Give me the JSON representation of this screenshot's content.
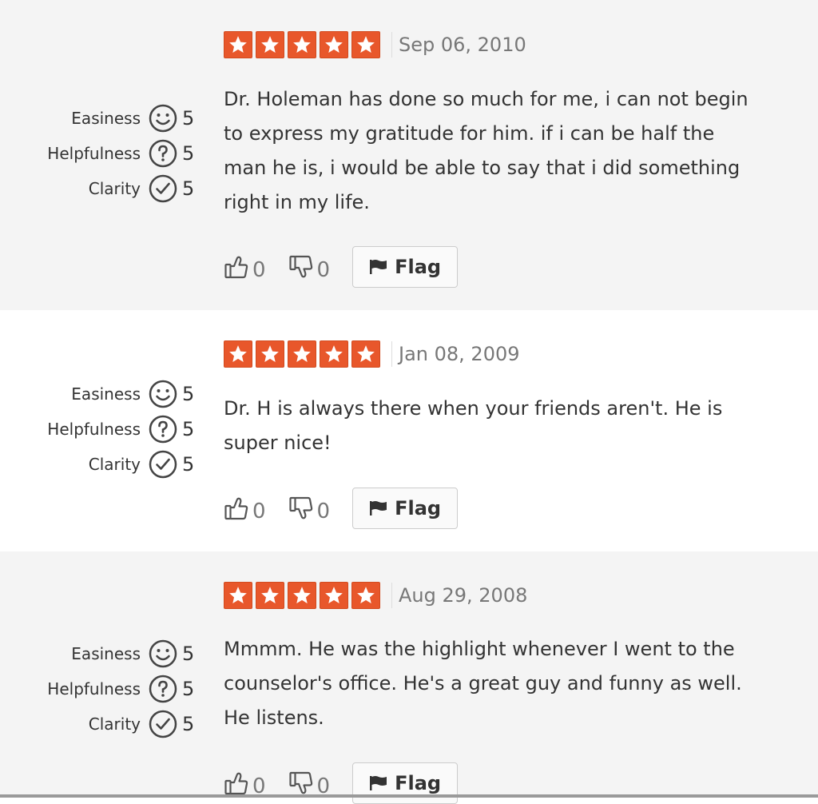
{
  "labels": {
    "easiness": "Easiness",
    "helpfulness": "Helpfulness",
    "clarity": "Clarity",
    "flag": "Flag"
  },
  "colors": {
    "star": "#e8572b",
    "shaded_bg": "#f4f4f4"
  },
  "icons": {
    "easiness": "smiley-icon",
    "helpfulness": "question-circle-icon",
    "clarity": "check-circle-icon",
    "thumbs_up": "thumbs-up-icon",
    "thumbs_down": "thumbs-down-icon",
    "flag": "flag-icon",
    "star": "star-icon"
  },
  "reviews": [
    {
      "date": "Sep 06, 2010",
      "stars": 5,
      "easiness": "5",
      "helpfulness": "5",
      "clarity": "5",
      "comment_lines": [
        "Dr. Holeman has done so much for me, i can not begin",
        "to express my gratitude for him. if i can be half the",
        "man he is, i would be able to say that i did something",
        "right in my life."
      ],
      "up": "0",
      "down": "0"
    },
    {
      "date": "Jan 08, 2009",
      "stars": 5,
      "easiness": "5",
      "helpfulness": "5",
      "clarity": "5",
      "comment_lines": [
        "Dr. H is always there when your friends aren't. He is",
        "super nice!"
      ],
      "up": "0",
      "down": "0"
    },
    {
      "date": "Aug 29, 2008",
      "stars": 5,
      "easiness": "5",
      "helpfulness": "5",
      "clarity": "5",
      "comment_lines": [
        "Mmmm. He was the highlight whenever I went to the",
        "counselor's office. He's a great guy and funny as well.",
        "He listens."
      ],
      "up": "0",
      "down": "0"
    }
  ]
}
